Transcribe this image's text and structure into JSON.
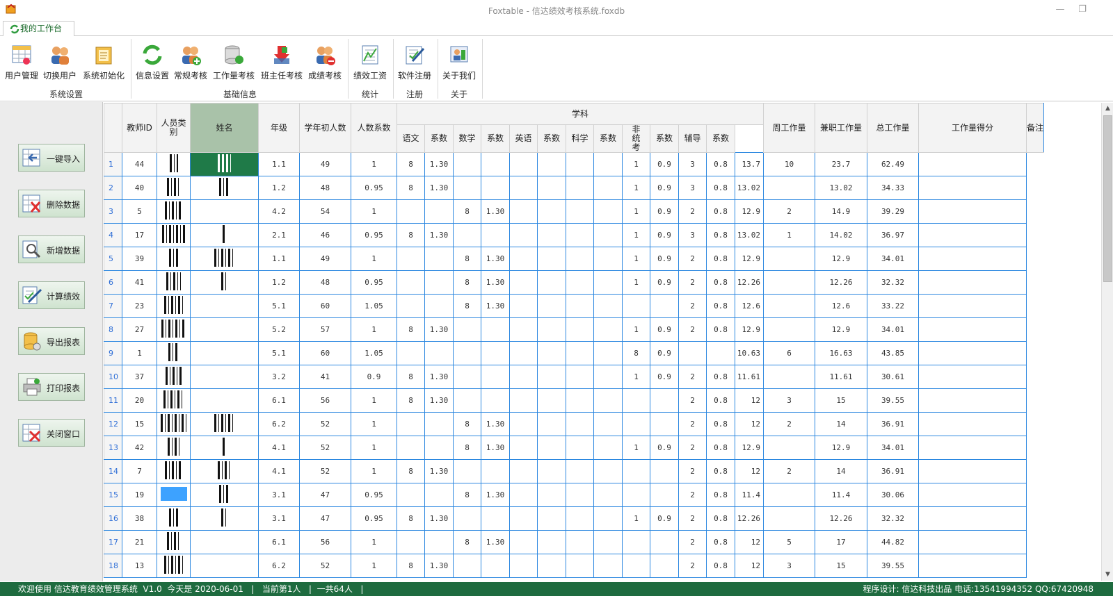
{
  "window": {
    "title": "Foxtable - 信达绩效考核系统.foxdb",
    "min": "—",
    "restore": "❐"
  },
  "tab": {
    "label": "我的工作台"
  },
  "ribbon": {
    "groups": [
      {
        "label": "系统设置",
        "buttons": [
          "用户管理",
          "切换用户",
          "系统初始化"
        ]
      },
      {
        "label": "基础信息",
        "buttons": [
          "信息设置",
          "常规考核",
          "工作量考核",
          "班主任考核",
          "成绩考核"
        ]
      },
      {
        "label": "统计",
        "buttons": [
          "绩效工资"
        ]
      },
      {
        "label": "注册",
        "buttons": [
          "软件注册"
        ]
      },
      {
        "label": "关于",
        "buttons": [
          "关于我们"
        ]
      }
    ]
  },
  "left": {
    "buttons": [
      "一键导入",
      "删除数据",
      "新增数据",
      "计算绩效",
      "导出报表",
      "打印报表",
      "关闭窗口"
    ]
  },
  "grid": {
    "headers": {
      "id": "教师ID",
      "type": "人员类别",
      "name": "姓名",
      "grade": "年级",
      "students": "学年初人数",
      "coef": "人数系数",
      "subject": "学科",
      "chinese": "语文",
      "c1": "系数",
      "math": "数学",
      "c2": "系数",
      "english": "英语",
      "c3": "系数",
      "science": "科学",
      "c4": "系数",
      "nontest": "非统考",
      "c5": "系数",
      "tutor": "辅导",
      "c6": "系数",
      "weekly": "周工作量",
      "parttime": "兼职工作量",
      "total": "总工作量",
      "score": "工作量得分",
      "remark": "备注"
    },
    "rows": [
      [
        "1",
        "44",
        "1.1",
        "49",
        "1",
        "8",
        "1.30",
        "",
        "",
        "",
        "",
        "",
        "",
        "1",
        "0.9",
        "3",
        "0.8",
        "13.7",
        "10",
        "23.7",
        "62.49"
      ],
      [
        "2",
        "40",
        "1.2",
        "48",
        "0.95",
        "8",
        "1.30",
        "",
        "",
        "",
        "",
        "",
        "",
        "1",
        "0.9",
        "3",
        "0.8",
        "13.02",
        "",
        "13.02",
        "34.33"
      ],
      [
        "3",
        "5",
        "4.2",
        "54",
        "1",
        "",
        "",
        "8",
        "1.30",
        "",
        "",
        "",
        "",
        "1",
        "0.9",
        "2",
        "0.8",
        "12.9",
        "2",
        "14.9",
        "39.29"
      ],
      [
        "4",
        "17",
        "2.1",
        "46",
        "0.95",
        "8",
        "1.30",
        "",
        "",
        "",
        "",
        "",
        "",
        "1",
        "0.9",
        "3",
        "0.8",
        "13.02",
        "1",
        "14.02",
        "36.97"
      ],
      [
        "5",
        "39",
        "1.1",
        "49",
        "1",
        "",
        "",
        "8",
        "1.30",
        "",
        "",
        "",
        "",
        "1",
        "0.9",
        "2",
        "0.8",
        "12.9",
        "",
        "12.9",
        "34.01"
      ],
      [
        "6",
        "41",
        "1.2",
        "48",
        "0.95",
        "",
        "",
        "8",
        "1.30",
        "",
        "",
        "",
        "",
        "1",
        "0.9",
        "2",
        "0.8",
        "12.26",
        "",
        "12.26",
        "32.32"
      ],
      [
        "7",
        "23",
        "5.1",
        "60",
        "1.05",
        "",
        "",
        "8",
        "1.30",
        "",
        "",
        "",
        "",
        "",
        "",
        "2",
        "0.8",
        "12.6",
        "",
        "12.6",
        "33.22"
      ],
      [
        "8",
        "27",
        "5.2",
        "57",
        "1",
        "8",
        "1.30",
        "",
        "",
        "",
        "",
        "",
        "",
        "1",
        "0.9",
        "2",
        "0.8",
        "12.9",
        "",
        "12.9",
        "34.01"
      ],
      [
        "9",
        "1",
        "5.1",
        "60",
        "1.05",
        "",
        "",
        "",
        "",
        "",
        "",
        "",
        "",
        "8",
        "0.9",
        "",
        "",
        "10.63",
        "6",
        "16.63",
        "43.85"
      ],
      [
        "10",
        "37",
        "3.2",
        "41",
        "0.9",
        "8",
        "1.30",
        "",
        "",
        "",
        "",
        "",
        "",
        "1",
        "0.9",
        "2",
        "0.8",
        "11.61",
        "",
        "11.61",
        "30.61"
      ],
      [
        "11",
        "20",
        "6.1",
        "56",
        "1",
        "8",
        "1.30",
        "",
        "",
        "",
        "",
        "",
        "",
        "",
        "",
        "2",
        "0.8",
        "12",
        "3",
        "15",
        "39.55"
      ],
      [
        "12",
        "15",
        "6.2",
        "52",
        "1",
        "",
        "",
        "8",
        "1.30",
        "",
        "",
        "",
        "",
        "",
        "",
        "2",
        "0.8",
        "12",
        "2",
        "14",
        "36.91"
      ],
      [
        "13",
        "42",
        "4.1",
        "52",
        "1",
        "",
        "",
        "8",
        "1.30",
        "",
        "",
        "",
        "",
        "1",
        "0.9",
        "2",
        "0.8",
        "12.9",
        "",
        "12.9",
        "34.01"
      ],
      [
        "14",
        "7",
        "4.1",
        "52",
        "1",
        "8",
        "1.30",
        "",
        "",
        "",
        "",
        "",
        "",
        "",
        "",
        "2",
        "0.8",
        "12",
        "2",
        "14",
        "36.91"
      ],
      [
        "15",
        "19",
        "3.1",
        "47",
        "0.95",
        "",
        "",
        "8",
        "1.30",
        "",
        "",
        "",
        "",
        "",
        "",
        "2",
        "0.8",
        "11.4",
        "",
        "11.4",
        "30.06"
      ],
      [
        "16",
        "38",
        "3.1",
        "47",
        "0.95",
        "8",
        "1.30",
        "",
        "",
        "",
        "",
        "",
        "",
        "1",
        "0.9",
        "2",
        "0.8",
        "12.26",
        "",
        "12.26",
        "32.32"
      ],
      [
        "17",
        "21",
        "6.1",
        "56",
        "1",
        "",
        "",
        "8",
        "1.30",
        "",
        "",
        "",
        "",
        "",
        "",
        "2",
        "0.8",
        "12",
        "5",
        "17",
        "44.82"
      ],
      [
        "18",
        "13",
        "6.2",
        "52",
        "1",
        "8",
        "1.30",
        "",
        "",
        "",
        "",
        "",
        "",
        "",
        "",
        "2",
        "0.8",
        "12",
        "3",
        "15",
        "39.55"
      ]
    ]
  },
  "status": {
    "left": "欢迎使用 信达教育绩效管理系统  V1.0  今天是 2020-06-01   |   当前第1人   |  一共64人   |",
    "right": "程序设计: 信达科技出品 电话:13541994352 QQ:67420948"
  }
}
